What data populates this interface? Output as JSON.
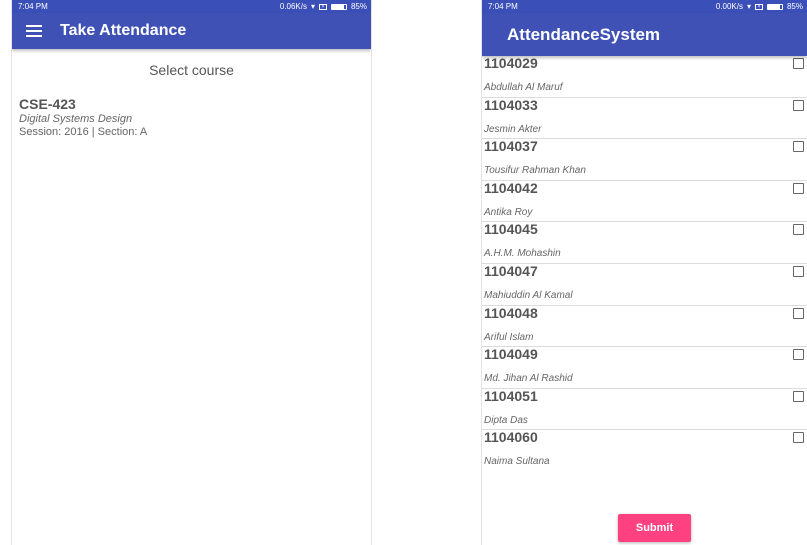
{
  "left": {
    "status": {
      "time": "7:04 PM",
      "speed": "0.06K/s",
      "battery": "85%",
      "battery_level": 0.85
    },
    "appbar": {
      "title": "Take Attendance"
    },
    "select_label": "Select course",
    "course": {
      "code": "CSE-423",
      "name": "Digital Systems Design",
      "session": "Session: 2016 | Section: A"
    }
  },
  "right": {
    "status": {
      "time": "7:04 PM",
      "speed": "0.00K/s",
      "battery": "85%",
      "battery_level": 0.85
    },
    "appbar": {
      "title": "AttendanceSystem"
    },
    "students": [
      {
        "id": "1104029",
        "name": "Abdullah Al Maruf",
        "checked": false
      },
      {
        "id": "1104033",
        "name": "Jesmin Akter",
        "checked": false
      },
      {
        "id": "1104037",
        "name": "Tousifur Rahman Khan",
        "checked": false
      },
      {
        "id": "1104042",
        "name": "Antika Roy",
        "checked": false
      },
      {
        "id": "1104045",
        "name": "A.H.M. Mohashin",
        "checked": false
      },
      {
        "id": "1104047",
        "name": "Mahiuddin Al Kamal",
        "checked": false
      },
      {
        "id": "1104048",
        "name": "Ariful Islam",
        "checked": false
      },
      {
        "id": "1104049",
        "name": "Md. Jihan Al Rashid",
        "checked": false
      },
      {
        "id": "1104051",
        "name": "Dipta Das",
        "checked": false
      },
      {
        "id": "1104060",
        "name": "Naima Sultana",
        "checked": false
      }
    ],
    "submit_label": "Submit"
  },
  "colors": {
    "primary": "#3f51b5",
    "status_bar": "#3b4fb8",
    "accent": "#ff4081"
  }
}
